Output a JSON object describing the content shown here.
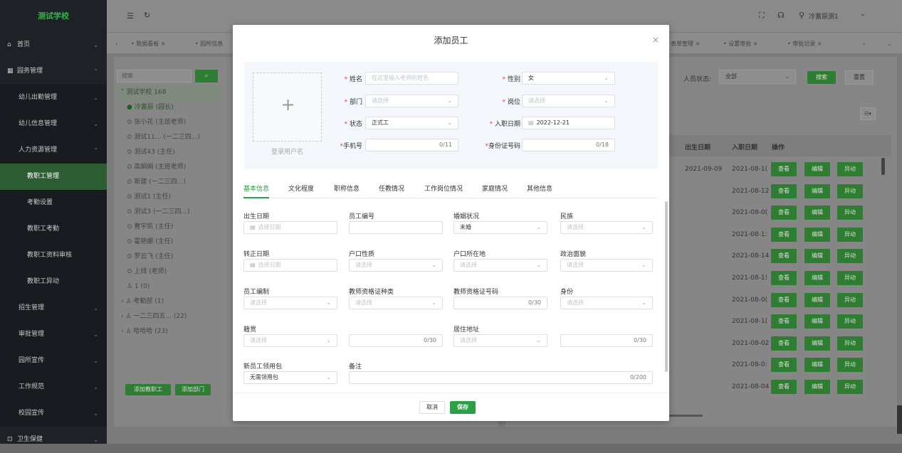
{
  "sidebar": {
    "title": "测试学校",
    "items": [
      {
        "label": "首页",
        "icon": "home-icon"
      },
      {
        "label": "园务管理",
        "icon": "building-icon"
      },
      {
        "label": "幼儿出勤管理"
      },
      {
        "label": "幼儿信息管理"
      },
      {
        "label": "人力资源管理"
      },
      {
        "label": "教职工管理"
      },
      {
        "label": "考勤设置"
      },
      {
        "label": "教职工考勤"
      },
      {
        "label": "教职工资料审核"
      },
      {
        "label": "教职工异动"
      },
      {
        "label": "招生管理"
      },
      {
        "label": "审批管理"
      },
      {
        "label": "园所宣传"
      },
      {
        "label": "工作规范"
      },
      {
        "label": "校园宣传"
      },
      {
        "label": "卫生保健",
        "icon": "health-icon"
      }
    ]
  },
  "header": {
    "user": "冷富辰测1"
  },
  "tabs": [
    {
      "label": "数据看板"
    },
    {
      "label": "园所信息"
    },
    {
      "label": "表单管理"
    },
    {
      "label": "设置审批"
    },
    {
      "label": "审批记录"
    }
  ],
  "tree": {
    "search_placeholder": "搜索",
    "root": "测试学校 168",
    "items": [
      "冷富辰 (园长)",
      "张小花 (主班老师)",
      "测试11... (一二三四...)",
      "测试43 (主任)",
      "高娟娟 (主班老师)",
      "新建 (一二三四...)",
      "测试1 (主任)",
      "测试3 (一二三四...)",
      "曹宇凯 (主任)",
      "霍艳娜 (主任)",
      "罗云飞 (主任)",
      "上线 (老师)",
      "1 (0)",
      "考勤部 (1)",
      "一二三四五... (22)",
      "哈哈哈 (23)"
    ],
    "btn_add_staff": "添加教职工",
    "btn_add_dept": "添加部门"
  },
  "filters": {
    "status_label": "人员状态:",
    "status_value": "全部",
    "search_btn": "搜索",
    "reset_btn": "重置"
  },
  "table": {
    "col_birth": "出生日期",
    "col_join": "入职日期",
    "col_ops": "操作",
    "rows": [
      {
        "birth": "2021-09-09",
        "join": "2021-08-1("
      },
      {
        "birth": "",
        "join": "2021-08-12"
      },
      {
        "birth": "",
        "join": "2021-08-0("
      },
      {
        "birth": "",
        "join": "2021-08-1:"
      },
      {
        "birth": "",
        "join": "2021-08-14"
      },
      {
        "birth": "",
        "join": "2021-08-1!"
      },
      {
        "birth": "",
        "join": "2021-08-0("
      },
      {
        "birth": "",
        "join": "2021-08-1("
      },
      {
        "birth": "",
        "join": "2021-08-02"
      },
      {
        "birth": "",
        "join": "2021-08-0:"
      },
      {
        "birth": "",
        "join": "2021-08-04"
      }
    ],
    "op_view": "查看",
    "op_edit": "编辑",
    "op_move": "异动"
  },
  "modal": {
    "title": "添加员工",
    "avatar_label": "登录用户名",
    "name_label": "姓名",
    "name_placeholder": "在这里输入老师的姓名",
    "gender_label": "性别",
    "gender_value": "女",
    "dept_label": "部门",
    "dept_placeholder": "请选择",
    "post_label": "岗位",
    "post_placeholder": "请选择",
    "status_label": "状态",
    "status_value": "正式工",
    "join_label": "入职日期",
    "join_value": "2022-12-21",
    "phone_label": "手机号",
    "phone_count": "0/11",
    "idcard_label": "身份证号码",
    "idcard_count": "0/18",
    "tabs": [
      "基本信息",
      "文化程度",
      "职称信息",
      "任教情况",
      "工作岗位情况",
      "家庭情况",
      "其他信息"
    ],
    "fields": {
      "birth_label": "出生日期",
      "birth_placeholder": "选择日期",
      "staff_no_label": "员工编号",
      "marital_label": "婚姻状况",
      "marital_value": "未婚",
      "ethnic_label": "民族",
      "ethnic_placeholder": "请选择",
      "regular_label": "转正日期",
      "regular_placeholder": "选择日期",
      "hukou_type_label": "户口性质",
      "hukou_type_placeholder": "请选择",
      "hukou_loc_label": "户口所在地",
      "hukou_loc_placeholder": "请选择",
      "political_label": "政治面貌",
      "political_placeholder": "请选择",
      "staffing_label": "员工编制",
      "staffing_placeholder": "请选择",
      "cert_type_label": "教师资格证种类",
      "cert_type_placeholder": "请选择",
      "cert_no_label": "教师资格证号码",
      "cert_no_count": "0/30",
      "identity_label": "身份",
      "identity_placeholder": "请选择",
      "native_label": "籍贯",
      "native_placeholder": "请选择",
      "native_count": "0/30",
      "address_label": "居住地址",
      "address_placeholder": "请选择",
      "address_count": "0/30",
      "package_label": "新员工领用包",
      "package_value": "无需领用包",
      "remark_label": "备注",
      "remark_count": "0/200"
    },
    "cancel": "取消",
    "save": "保存"
  }
}
